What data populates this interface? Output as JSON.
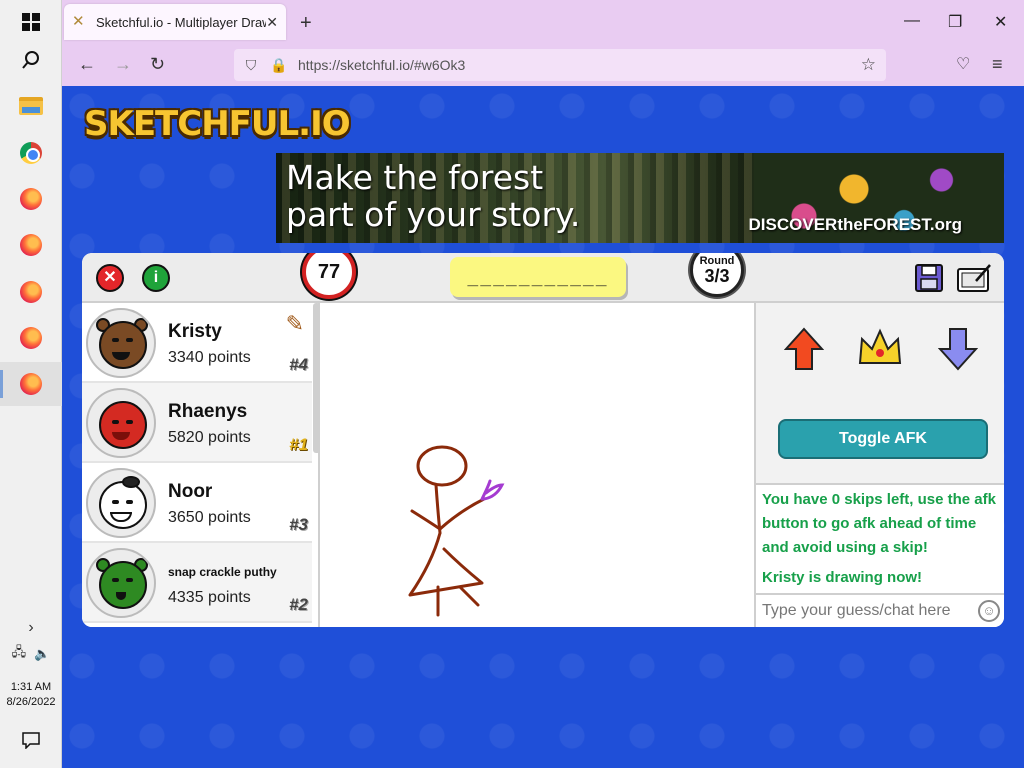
{
  "taskbar": {
    "time": "1:31 AM",
    "date": "8/26/2022"
  },
  "browser": {
    "tab_title": "Sketchful.io - Multiplayer Drawi",
    "url": "https://sketchful.io/#w6Ok3"
  },
  "ad": {
    "headline_line1": "Make the forest",
    "headline_line2": "part of your story.",
    "brand": "DISCOVERtheFOREST.org"
  },
  "game": {
    "logo": "SKETCHFUL.IO",
    "timer": "77",
    "word_hint": "___________",
    "round_label": "Round",
    "round_value": "3/3"
  },
  "players": [
    {
      "name": "Kristy",
      "points": "3340 points",
      "rank": "#4",
      "drawing": true,
      "color": "#7a4a24"
    },
    {
      "name": "Rhaenys",
      "points": "5820 points",
      "rank": "#1",
      "drawing": false,
      "color": "#d42a22"
    },
    {
      "name": "Noor",
      "points": "3650 points",
      "rank": "#3",
      "drawing": false,
      "color": "#ffffff"
    },
    {
      "name": "snap crackle puthy",
      "points": "4335 points",
      "rank": "#2",
      "drawing": false,
      "color": "#2e8a22"
    }
  ],
  "right_panel": {
    "afk_button": "Toggle AFK",
    "chat_messages": [
      "You have 0 skips left, use the afk button to go afk ahead of time and avoid using a skip!",
      "Kristy is drawing now!"
    ],
    "chat_placeholder": "Type your guess/chat here"
  },
  "colors": {
    "page_bg": "#1f4fd8",
    "browser_bg": "#e9ccf2",
    "afk": "#2aa1ad",
    "chat_system": "#17a04a",
    "drawing_stroke": "#8b2a0a",
    "drawing_accent": "#a53bd1"
  }
}
